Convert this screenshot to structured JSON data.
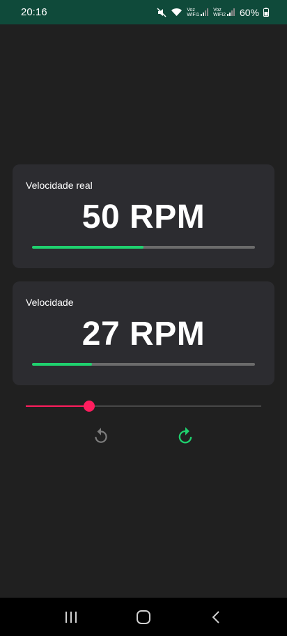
{
  "status_bar": {
    "time": "20:16",
    "volte_1": "Voz\nWiFi1",
    "volte_2": "Voz\nWiFi2",
    "battery": "60%"
  },
  "cards": [
    {
      "label": "Velocidade real",
      "value": "50 RPM",
      "progress": 0.5
    },
    {
      "label": "Velocidade",
      "value": "27 RPM",
      "progress": 0.27
    }
  ],
  "slider": {
    "value": 0.27
  },
  "buttons": {
    "rotate_left_icon": "rotate-ccw-icon",
    "rotate_right_icon": "rotate-cw-icon"
  },
  "colors": {
    "accent_green": "#1fd16e",
    "accent_pink": "#ff1d5e",
    "status_bar": "#0f4a3a",
    "card": "#2c2c30",
    "background": "#202020"
  }
}
